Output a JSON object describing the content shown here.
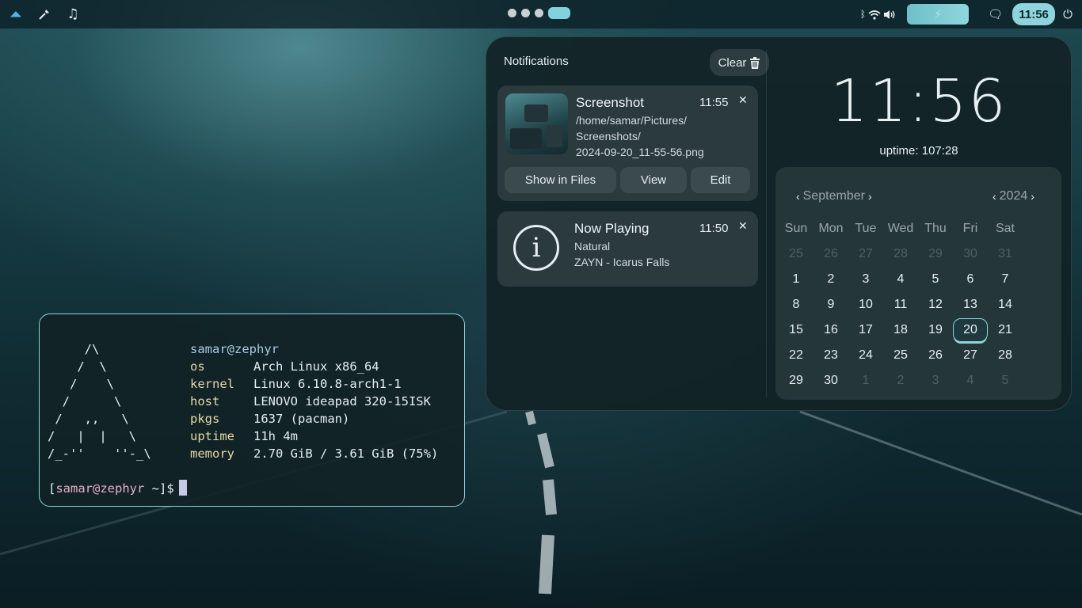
{
  "topbar": {
    "left_icons": [
      "arch-logo-icon",
      "color-picker-icon",
      "music-note-icon"
    ],
    "workspaces": {
      "count": 4,
      "active_index": 3
    },
    "status_icons": [
      "bluetooth-icon",
      "wifi-icon",
      "volume-icon"
    ],
    "battery_icon": "charging-bolt-icon",
    "clock": "11:56"
  },
  "notifications": {
    "header": "Notifications",
    "clear_label": "Clear",
    "items": [
      {
        "title": "Screenshot",
        "time": "11:55",
        "body_lines": [
          "/home/samar/Pictures/",
          "Screenshots/",
          "2024-09-20_11-55-56.png"
        ],
        "actions": [
          "Show in Files",
          "View",
          "Edit"
        ]
      },
      {
        "title": "Now Playing",
        "time": "11:50",
        "body_lines": [
          "Natural",
          "ZAYN - Icarus Falls"
        ]
      }
    ]
  },
  "clock": {
    "time": "11:56",
    "uptime": "uptime: 107:28"
  },
  "calendar": {
    "month": "September",
    "year": "2024",
    "weekdays": [
      "Sun",
      "Mon",
      "Tue",
      "Wed",
      "Thu",
      "Fri",
      "Sat"
    ],
    "today": "20",
    "days": [
      {
        "d": "25",
        "m": true
      },
      {
        "d": "26",
        "m": true
      },
      {
        "d": "27",
        "m": true
      },
      {
        "d": "28",
        "m": true
      },
      {
        "d": "29",
        "m": true
      },
      {
        "d": "30",
        "m": true
      },
      {
        "d": "31",
        "m": true
      },
      {
        "d": "1"
      },
      {
        "d": "2"
      },
      {
        "d": "3"
      },
      {
        "d": "4"
      },
      {
        "d": "5"
      },
      {
        "d": "6"
      },
      {
        "d": "7"
      },
      {
        "d": "8"
      },
      {
        "d": "9"
      },
      {
        "d": "10"
      },
      {
        "d": "11"
      },
      {
        "d": "12"
      },
      {
        "d": "13"
      },
      {
        "d": "14"
      },
      {
        "d": "15"
      },
      {
        "d": "16"
      },
      {
        "d": "17"
      },
      {
        "d": "18"
      },
      {
        "d": "19"
      },
      {
        "d": "20"
      },
      {
        "d": "21"
      },
      {
        "d": "22"
      },
      {
        "d": "23"
      },
      {
        "d": "24"
      },
      {
        "d": "25"
      },
      {
        "d": "26"
      },
      {
        "d": "27"
      },
      {
        "d": "28"
      },
      {
        "d": "29"
      },
      {
        "d": "30"
      },
      {
        "d": "1",
        "m": true
      },
      {
        "d": "2",
        "m": true
      },
      {
        "d": "3",
        "m": true
      },
      {
        "d": "4",
        "m": true
      },
      {
        "d": "5",
        "m": true
      }
    ]
  },
  "terminal": {
    "ascii_art": "     /\\\n    /  \\\n   /    \\\n  /      \\\n /   ,,   \\\n/   |  |   \\\n/_-''    ''-_\\",
    "user_host": "samar@zephyr",
    "fields": [
      {
        "key": "os",
        "value": "Arch Linux x86_64"
      },
      {
        "key": "kernel",
        "value": "Linux 6.10.8-arch1-1"
      },
      {
        "key": "host",
        "value": "LENOVO ideapad 320-15ISK"
      },
      {
        "key": "pkgs",
        "value": "1637 (pacman)"
      },
      {
        "key": "uptime",
        "value": "11h 4m"
      },
      {
        "key": "memory",
        "value": "2.70 GiB / 3.61 GiB (75%)"
      }
    ],
    "prompt_open": "[",
    "prompt_user": "samar@zephyr",
    "prompt_rest": " ~]$"
  },
  "colors": {
    "accent": "#8fd4dc",
    "panel_bg": "#122226",
    "card_bg": "#2a3a3d",
    "fetch_key": "#e6d9a8",
    "prompt_user": "#e3b0c6"
  }
}
